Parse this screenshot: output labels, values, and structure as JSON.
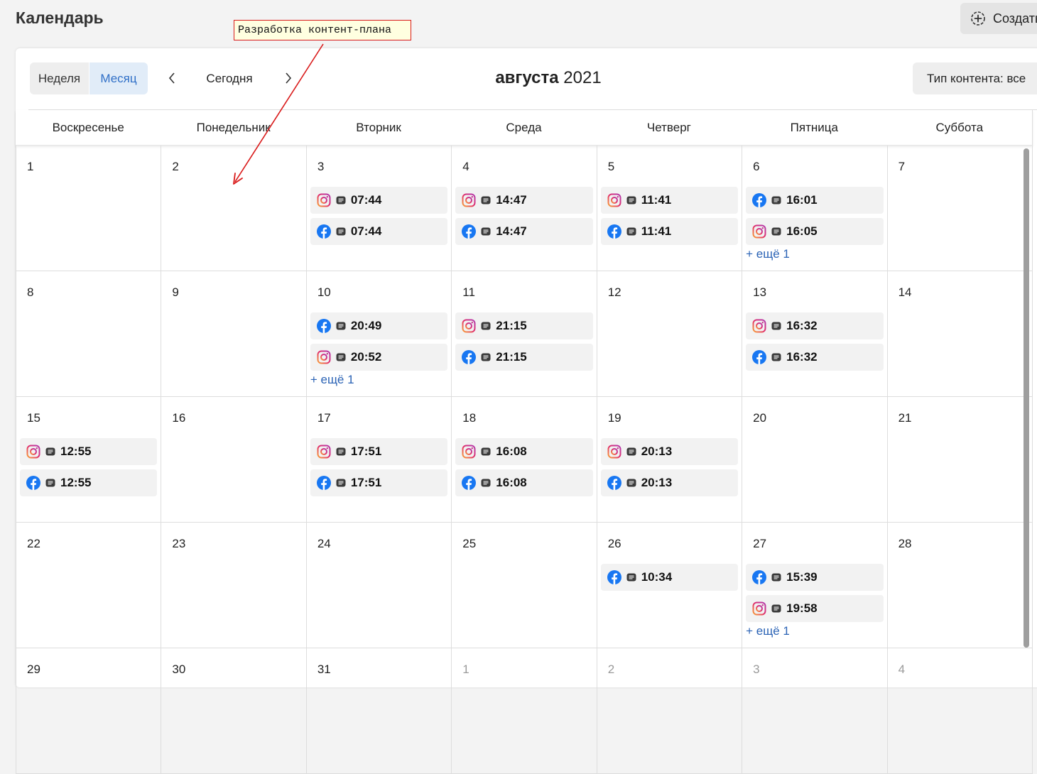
{
  "header": {
    "title": "Календарь",
    "create_label": "Создать"
  },
  "annotation": {
    "text": "Разработка контент-плана"
  },
  "toolbar": {
    "week_label": "Неделя",
    "month_label": "Месяц",
    "today_label": "Сегодня",
    "month_name": "августа",
    "year": "2021",
    "content_type_label": "Тип контента: все"
  },
  "weekdays": [
    "Воскресенье",
    "Понедельник",
    "Вторник",
    "Среда",
    "Четверг",
    "Пятница",
    "Суббота"
  ],
  "days": [
    {
      "num": "1",
      "posts": []
    },
    {
      "num": "2",
      "posts": []
    },
    {
      "num": "3",
      "posts": [
        {
          "network": "instagram",
          "time": "07:44"
        },
        {
          "network": "facebook",
          "time": "07:44"
        }
      ]
    },
    {
      "num": "4",
      "posts": [
        {
          "network": "instagram",
          "time": "14:47"
        },
        {
          "network": "facebook",
          "time": "14:47"
        }
      ]
    },
    {
      "num": "5",
      "posts": [
        {
          "network": "instagram",
          "time": "11:41"
        },
        {
          "network": "facebook",
          "time": "11:41"
        }
      ]
    },
    {
      "num": "6",
      "posts": [
        {
          "network": "facebook",
          "time": "16:01"
        },
        {
          "network": "instagram",
          "time": "16:05"
        }
      ],
      "more": "+ ещё 1"
    },
    {
      "num": "7",
      "posts": []
    },
    {
      "num": "8",
      "posts": []
    },
    {
      "num": "9",
      "posts": []
    },
    {
      "num": "10",
      "posts": [
        {
          "network": "facebook",
          "time": "20:49"
        },
        {
          "network": "instagram",
          "time": "20:52"
        }
      ],
      "more": "+ ещё 1"
    },
    {
      "num": "11",
      "posts": [
        {
          "network": "instagram",
          "time": "21:15"
        },
        {
          "network": "facebook",
          "time": "21:15"
        }
      ]
    },
    {
      "num": "12",
      "posts": []
    },
    {
      "num": "13",
      "posts": [
        {
          "network": "instagram",
          "time": "16:32"
        },
        {
          "network": "facebook",
          "time": "16:32"
        }
      ]
    },
    {
      "num": "14",
      "posts": []
    },
    {
      "num": "15",
      "posts": [
        {
          "network": "instagram",
          "time": "12:55"
        },
        {
          "network": "facebook",
          "time": "12:55"
        }
      ]
    },
    {
      "num": "16",
      "posts": []
    },
    {
      "num": "17",
      "posts": [
        {
          "network": "instagram",
          "time": "17:51"
        },
        {
          "network": "facebook",
          "time": "17:51"
        }
      ]
    },
    {
      "num": "18",
      "posts": [
        {
          "network": "instagram",
          "time": "16:08"
        },
        {
          "network": "facebook",
          "time": "16:08"
        }
      ]
    },
    {
      "num": "19",
      "posts": [
        {
          "network": "instagram",
          "time": "20:13"
        },
        {
          "network": "facebook",
          "time": "20:13"
        }
      ]
    },
    {
      "num": "20",
      "posts": []
    },
    {
      "num": "21",
      "posts": []
    },
    {
      "num": "22",
      "posts": []
    },
    {
      "num": "23",
      "posts": []
    },
    {
      "num": "24",
      "posts": []
    },
    {
      "num": "25",
      "posts": []
    },
    {
      "num": "26",
      "posts": [
        {
          "network": "facebook",
          "time": "10:34"
        }
      ]
    },
    {
      "num": "27",
      "posts": [
        {
          "network": "facebook",
          "time": "15:39"
        },
        {
          "network": "instagram",
          "time": "19:58"
        }
      ],
      "more": "+ ещё 1"
    },
    {
      "num": "28",
      "posts": []
    },
    {
      "num": "29",
      "posts": []
    },
    {
      "num": "30",
      "posts": []
    },
    {
      "num": "31",
      "posts": []
    },
    {
      "num": "1",
      "posts": [],
      "other": true
    },
    {
      "num": "2",
      "posts": [],
      "other": true
    },
    {
      "num": "3",
      "posts": [],
      "other": true
    },
    {
      "num": "4",
      "posts": [],
      "other": true
    }
  ],
  "colors": {
    "accent": "#2f6fc7",
    "link": "#2b63b5",
    "facebook": "#1877f2",
    "annotation_border": "#d91a1a"
  },
  "icons": {
    "instagram": "instagram-icon",
    "facebook": "facebook-icon",
    "post_type": "text-post-icon"
  }
}
